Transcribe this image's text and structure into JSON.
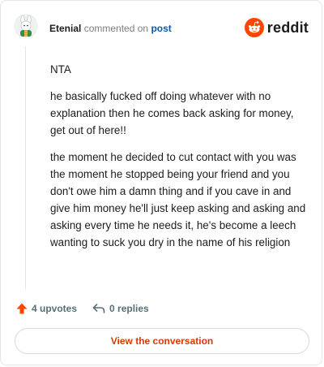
{
  "header": {
    "author": "Etenial",
    "action_text": "commented on",
    "post_link": "post",
    "logo_word": "reddit",
    "logo_icon": "reddit-snoo-icon",
    "accent_color": "#ff4500"
  },
  "comment": {
    "paragraphs": [
      "NTA",
      "he basically fucked off doing whatever with no explanation then he comes back asking for money, get out of here!!",
      "the moment he decided to cut contact with you was the moment he stopped being your friend and you don't owe him a damn thing and if you cave in and give him money he'll just keep asking and asking and asking every time he needs it, he's become a leech wanting to suck you dry in the name of his religion"
    ]
  },
  "actions": {
    "upvotes": "4 upvotes",
    "upvote_icon": "upvote-arrow-icon",
    "replies": "0 replies",
    "reply_icon": "reply-arrow-icon"
  },
  "footer": {
    "view_button": "View the conversation"
  }
}
